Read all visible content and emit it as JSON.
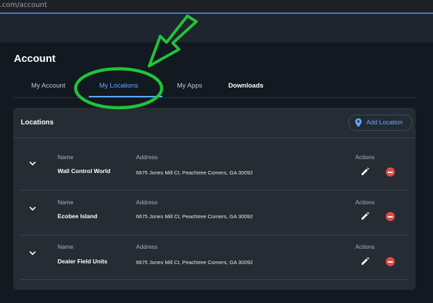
{
  "browser": {
    "url": ".com/account"
  },
  "page": {
    "title": "Account"
  },
  "tabs": [
    {
      "label": "My Account",
      "active": false
    },
    {
      "label": "My Locations",
      "active": true
    },
    {
      "label": "My Apps",
      "active": false
    },
    {
      "label": "Downloads",
      "active": false
    }
  ],
  "locations": {
    "title": "Locations",
    "add_label": "Add Location",
    "columns": {
      "name": "Name",
      "address": "Address",
      "actions": "Actions"
    },
    "rows": [
      {
        "name": "Wall Control World",
        "address": "6675 Jones Mill Ct, Peachtree Corners, GA 30092"
      },
      {
        "name": "Ecobee Island",
        "address": "6675 Jones Mill Ct, Peachtree Corners, GA 30092"
      },
      {
        "name": "Dealer Field Units",
        "address": "6675 Jones Mill Ct, Peachtree Corners, GA 30092"
      }
    ]
  },
  "colors": {
    "accent": "#5ea9ff",
    "annotation": "#22c33a",
    "delete": "#e4484a",
    "panel": "#262c33"
  },
  "icons": {
    "chevron": "chevron-down-icon",
    "pin": "location-pin-icon",
    "edit": "pencil-icon",
    "delete": "remove-circle-icon"
  }
}
